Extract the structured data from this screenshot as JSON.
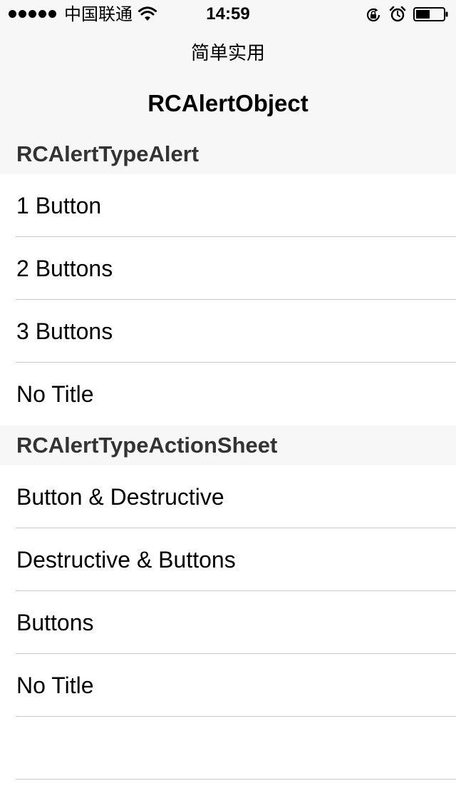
{
  "status_bar": {
    "carrier": "中国联通",
    "time": "14:59"
  },
  "nav": {
    "prompt": "简单实用",
    "title": "RCAlertObject"
  },
  "sections": [
    {
      "header": "RCAlertTypeAlert",
      "rows": [
        "1 Button",
        "2 Buttons",
        "3 Buttons",
        "No Title"
      ]
    },
    {
      "header": "RCAlertTypeActionSheet",
      "rows": [
        "Button & Destructive",
        "Destructive & Buttons",
        "Buttons",
        "No Title",
        ""
      ]
    }
  ],
  "icons": {
    "signal": "signal-dots-icon",
    "wifi": "wifi-icon",
    "orientation_lock": "rotation-lock-icon",
    "alarm": "alarm-clock-icon",
    "battery": "battery-icon"
  }
}
